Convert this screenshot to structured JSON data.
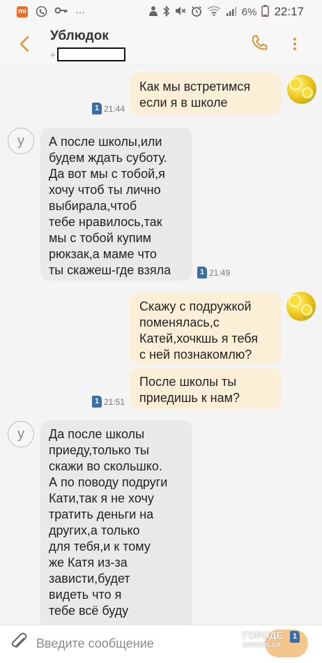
{
  "status_bar": {
    "battery": "6%",
    "time": "22:17",
    "icons": [
      "app-notification-icon",
      "viber-icon",
      "key-icon",
      "more-dots-icon",
      "person-icon",
      "bluetooth-icon",
      "mute-icon",
      "alarm-icon",
      "wifi-icon",
      "signal-icon"
    ]
  },
  "header": {
    "contact_name": "Ублюдок",
    "phone_prefix": "+"
  },
  "messages": [
    {
      "dir": "out",
      "text": "Как мы встретимся\nесли я в школе",
      "sim": "1",
      "time": "21:44"
    },
    {
      "dir": "in",
      "avatar_letter": "у",
      "text": "А после школы,или\nбудем ждать суботу.\nДа вот мы с тобой,я\nхочу чтоб ты лично\nвыбирала,чтоб\nтебе нравилось,так\nмы с тобой купим\nрюкзак,а маме что\nты скажеш-где взяла",
      "sim": "1",
      "time": "21:49"
    },
    {
      "dir": "out",
      "text": "Скажу с подружкой\nпоменялась,с\nКатей,хочкшь я тебя\nс ней познакомлю?"
    },
    {
      "dir": "out",
      "text": "После школы ты\nприедишь к нам?",
      "sim": "1",
      "time": "21:51"
    },
    {
      "dir": "in",
      "avatar_letter": "у",
      "text": "Да после школы\nприеду,только ты\nскажи во скольшко.\nА по поводу подруги\nКати,так я не хочу\nтратить деньги на\nдругих,а только\nдля тебя,и к тому\nже Катя из-за\nзависти,будет\nвидеть что я\nтебе всё буду"
    }
  ],
  "input": {
    "placeholder": "Введите сообщение",
    "send_sim": "1"
  },
  "watermark": {
    "line1": "ГОРОДЕ",
    "line2": "GORODE.UA"
  },
  "colors": {
    "accent": "#e1902f",
    "outgoing_bubble": "#fbefd7",
    "incoming_bubble": "#e9e9e9",
    "sim_badge": "#3a6ea5"
  }
}
